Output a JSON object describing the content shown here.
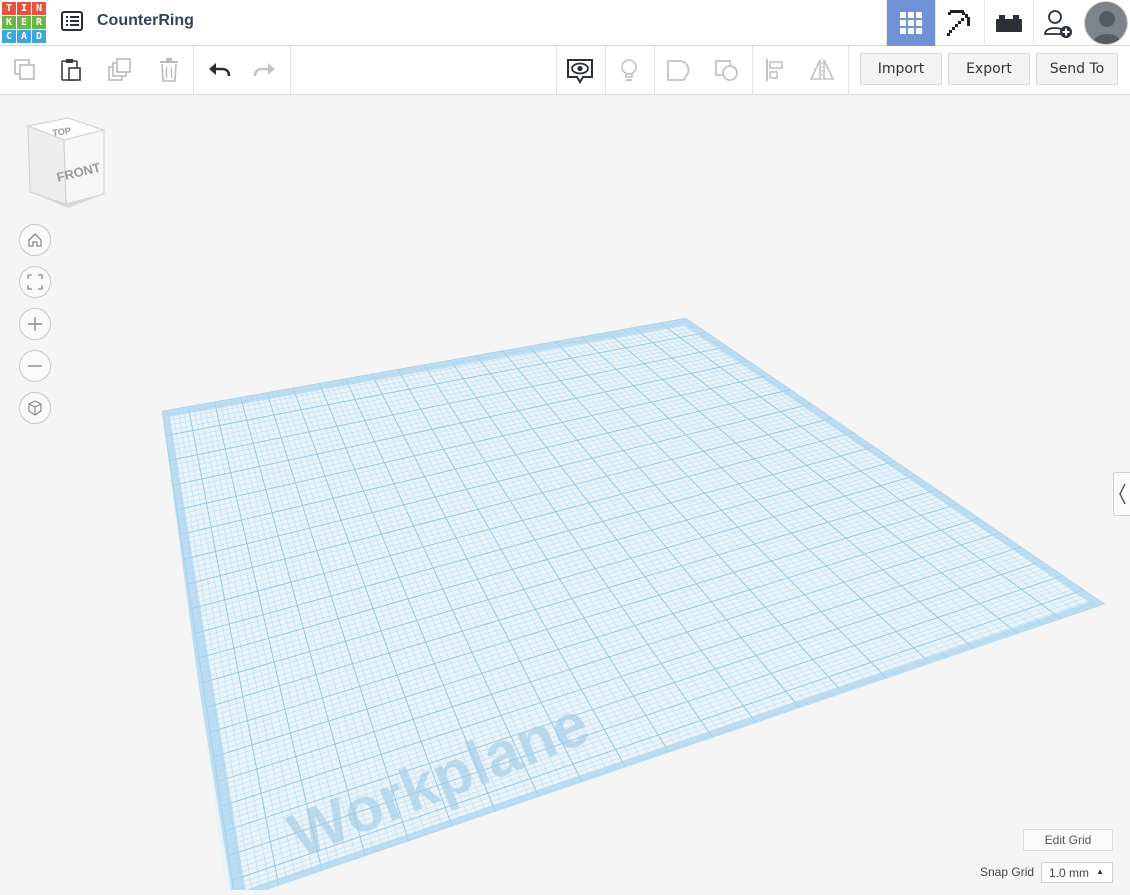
{
  "logo": {
    "letters": [
      "T",
      "I",
      "N",
      "K",
      "E",
      "R",
      "C",
      "A",
      "D"
    ],
    "colors": [
      "#e9523f",
      "#e9523f",
      "#e9523f",
      "#68b846",
      "#68b846",
      "#68b846",
      "#3ea5dd",
      "#3ea5dd",
      "#3ea5dd"
    ]
  },
  "header": {
    "title": "CounterRing",
    "active_view_color": "#6f91d6"
  },
  "toolbar": {
    "import_label": "Import",
    "export_label": "Export",
    "send_to_label": "Send To"
  },
  "viewcube": {
    "top_label": "TOP",
    "front_label": "FRONT"
  },
  "workplane": {
    "label": "Workplane",
    "grid_color": "#a9d3ee"
  },
  "grid_controls": {
    "edit_grid_label": "Edit Grid",
    "snap_grid_label": "Snap Grid",
    "snap_grid_value": "1.0 mm"
  },
  "icons": [
    "copy-icon",
    "paste-icon",
    "duplicate-icon",
    "delete-icon",
    "undo-icon",
    "redo-icon",
    "show-all-icon",
    "light-bulb-icon",
    "group-icon",
    "ungroup-icon",
    "align-icon",
    "mirror-icon",
    "grid-view-icon",
    "pickaxe-icon",
    "bricks-icon",
    "add-user-icon",
    "home-view-icon",
    "fit-view-icon",
    "zoom-in-icon",
    "zoom-out-icon",
    "perspective-icon",
    "chevron-left-icon"
  ]
}
